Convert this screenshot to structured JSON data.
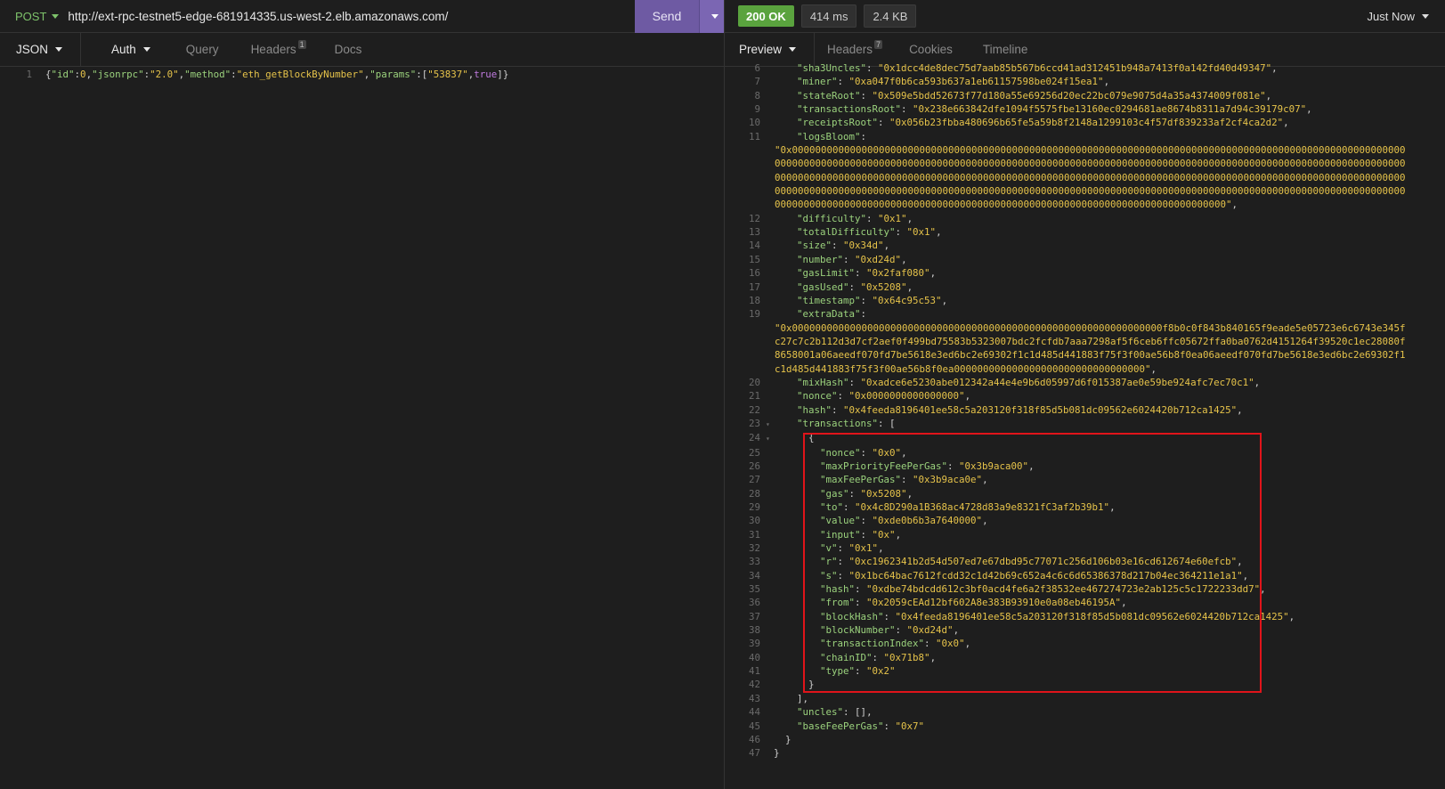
{
  "request": {
    "method": "POST",
    "url": "http://ext-rpc-testnet5-edge-681914335.us-west-2.elb.amazonaws.com/",
    "send_label": "Send",
    "tabs": [
      {
        "label": "JSON"
      },
      {
        "label": "Auth"
      },
      {
        "label": "Query"
      },
      {
        "label": "Headers",
        "count": "1"
      },
      {
        "label": "Docs"
      }
    ],
    "body_line_number": "1",
    "body": {
      "p1": "{",
      "k1": "\"id\"",
      "c1": ":",
      "v1": "0",
      "m1": ",",
      "k2": "\"jsonrpc\"",
      "c2": ":",
      "v2": "\"2.0\"",
      "m2": ",",
      "k3": "\"method\"",
      "c3": ":",
      "v3": "\"eth_getBlockByNumber\"",
      "m3": ",",
      "k4": "\"params\"",
      "c4": ":",
      "v4a": "[",
      "v4b": "\"53837\"",
      "v4c": ",",
      "v4d": "true",
      "v4e": "]",
      "p2": "}"
    }
  },
  "response": {
    "status": "200 OK",
    "time": "414 ms",
    "size": "2.4 KB",
    "timestamp_label": "Just Now",
    "tabs": [
      {
        "label": "Preview"
      },
      {
        "label": "Headers",
        "count": "7"
      },
      {
        "label": "Cookies"
      },
      {
        "label": "Timeline"
      }
    ],
    "lines": [
      {
        "n": "6",
        "ind": "    ",
        "key": "\"sha3Uncles\"",
        "val": "\"0x1dcc4de8dec75d7aab85b567b6ccd41ad312451b948a7413f0a142fd40d49347\"",
        "end": ","
      },
      {
        "n": "7",
        "ind": "    ",
        "key": "\"miner\"",
        "val": "\"0xa047f0b6ca593b637a1eb6115759​8be024f15ea1\"",
        "end": ","
      },
      {
        "n": "8",
        "ind": "    ",
        "key": "\"stateRoot\"",
        "val": "\"0x509e5bdd52673f77d180a55e69256d20ec22bc079e9075d4a35a4374009f081e\"",
        "end": ","
      },
      {
        "n": "9",
        "ind": "    ",
        "key": "\"transactionsRoot\"",
        "val": "\"0x238e663842dfe1094f5575fbe13160ec0294681ae8674b8311a7d94c39179c07\"",
        "end": ","
      },
      {
        "n": "10",
        "ind": "    ",
        "key": "\"receiptsRoot\"",
        "val": "\"0x056b23fbba480696b65fe5a59b8f2148a1299103c4f57df839233af2cf4ca2d2\"",
        "end": ","
      },
      {
        "n": "11",
        "ind": "    ",
        "key": "\"logsBloom\"",
        "val": "",
        "end": ""
      },
      {
        "n": "",
        "wrap": "\"0x0000000000000000000000000000000000000000000000000000000000000000000000000000000000000000000000000000000000000000000000000000000000000000000000000000000000000000000000000000000000000000000000000000000000000000000000000000000000000000000000000000000000000000000000000000000000000000000000000000000000000000000000000000000000000000000000000000000000000000000000000000000000000000000000000000000000000000000000000000000000000000000000000000000000000000000000000000000000000000000000000000000000000000000000000000000\""
      },
      {
        "n": "12",
        "ind": "    ",
        "key": "\"difficulty\"",
        "val": "\"0x1\"",
        "end": ","
      },
      {
        "n": "13",
        "ind": "    ",
        "key": "\"totalDifficulty\"",
        "val": "\"0x1\"",
        "end": ","
      },
      {
        "n": "14",
        "ind": "    ",
        "key": "\"size\"",
        "val": "\"0x34d\"",
        "end": ","
      },
      {
        "n": "15",
        "ind": "    ",
        "key": "\"number\"",
        "val": "\"0xd24d\"",
        "end": ","
      },
      {
        "n": "16",
        "ind": "    ",
        "key": "\"gasLimit\"",
        "val": "\"0x2faf080\"",
        "end": ","
      },
      {
        "n": "17",
        "ind": "    ",
        "key": "\"gasUsed\"",
        "val": "\"0x5208\"",
        "end": ","
      },
      {
        "n": "18",
        "ind": "    ",
        "key": "\"timestamp\"",
        "val": "\"0x64c95c53\"",
        "end": ","
      },
      {
        "n": "19",
        "ind": "    ",
        "key": "\"extraData\"",
        "val": "",
        "end": ""
      },
      {
        "n": "",
        "wrap": "\"0x0000000000000000000000000000000000000000000000000000000000000000f8b0c0f843b840165f9eade5e05723e6c6743e345fc27c7c2b112d3d7cf2aef0f499bd75583b5323007bdc2fcfdb7aaa7298af5f6ceb6ffc05672ffa0ba0762d4151264f39520c1ec28080f8658001a06aeedf070fd7be5618e3ed6bc2e69302f1c1d485d441883f75f3f00ae56b8f0ea06aeedf070fd7be5618e3ed6bc2e69302f1c1d485d441883f75f3f00ae56b8f0ea000000000000000000000000000000000\""
      },
      {
        "n": "20",
        "ind": "    ",
        "key": "\"mixHash\"",
        "val": "\"0xadce6e5230abe012342a44e4e9b6d05997d6f015387ae0e59be924afc7ec70c1\"",
        "end": ","
      },
      {
        "n": "21",
        "ind": "    ",
        "key": "\"nonce\"",
        "val": "\"0x0000000000000000\"",
        "end": ","
      },
      {
        "n": "22",
        "ind": "    ",
        "key": "\"hash\"",
        "val": "\"0x4feeda8196401ee58c5a203120f318f85d5b081dc09562e6024420b712ca1425\"",
        "end": ","
      },
      {
        "n": "23",
        "ind": "    ",
        "key": "\"transactions\"",
        "val": "[",
        "end": "",
        "fold": true
      },
      {
        "n": "24",
        "ind": "      ",
        "punct": "{",
        "fold": true
      },
      {
        "n": "25",
        "ind": "        ",
        "key": "\"nonce\"",
        "val": "\"0x0\"",
        "end": ","
      },
      {
        "n": "26",
        "ind": "        ",
        "key": "\"maxPriorityFeePerGas\"",
        "val": "\"0x3b9aca00\"",
        "end": ","
      },
      {
        "n": "27",
        "ind": "        ",
        "key": "\"maxFeePerGas\"",
        "val": "\"0x3b9aca0e\"",
        "end": ","
      },
      {
        "n": "28",
        "ind": "        ",
        "key": "\"gas\"",
        "val": "\"0x5208\"",
        "end": ","
      },
      {
        "n": "29",
        "ind": "        ",
        "key": "\"to\"",
        "val": "\"0x4c8D290a1B368ac4728d83a9e8321fC3af2b39b1\"",
        "end": ","
      },
      {
        "n": "30",
        "ind": "        ",
        "key": "\"value\"",
        "val": "\"0xde0b6b3a7640000\"",
        "end": ","
      },
      {
        "n": "31",
        "ind": "        ",
        "key": "\"input\"",
        "val": "\"0x\"",
        "end": ","
      },
      {
        "n": "32",
        "ind": "        ",
        "key": "\"v\"",
        "val": "\"0x1\"",
        "end": ","
      },
      {
        "n": "33",
        "ind": "        ",
        "key": "\"r\"",
        "val": "\"0xc1962341b2d54d507ed7e67dbd95c77071c256d106b03e16cd612674e60efcb\"",
        "end": ","
      },
      {
        "n": "34",
        "ind": "        ",
        "key": "\"s\"",
        "val": "\"0x1bc64bac7612fcdd32c1d42b69c652a4c6c6d65386378d217b04ec364211e1a1\"",
        "end": ","
      },
      {
        "n": "35",
        "ind": "        ",
        "key": "\"hash\"",
        "val": "\"0xdbe74bdcdd612c3bf0acd4fe6a2f38532ee467274723e2ab125c5c1722233dd7\"",
        "end": ","
      },
      {
        "n": "36",
        "ind": "        ",
        "key": "\"from\"",
        "val": "\"0x2059cEAd12bf602A8e383B93910e0a08eb46195A\"",
        "end": ","
      },
      {
        "n": "37",
        "ind": "        ",
        "key": "\"blockHash\"",
        "val": "\"0x4feeda8196401ee58c5a203120f318f85d5b081dc09562e6024420b712ca1425\"",
        "end": ","
      },
      {
        "n": "38",
        "ind": "        ",
        "key": "\"blockNumber\"",
        "val": "\"0xd24d\"",
        "end": ","
      },
      {
        "n": "39",
        "ind": "        ",
        "key": "\"transactionIndex\"",
        "val": "\"0x0\"",
        "end": ","
      },
      {
        "n": "40",
        "ind": "        ",
        "key": "\"chainID\"",
        "val": "\"0x71b8\"",
        "end": ","
      },
      {
        "n": "41",
        "ind": "        ",
        "key": "\"type\"",
        "val": "\"0x2\"",
        "end": ""
      },
      {
        "n": "42",
        "ind": "      ",
        "punct": "}"
      },
      {
        "n": "43",
        "ind": "    ",
        "punct": "],"
      },
      {
        "n": "44",
        "ind": "    ",
        "key": "\"uncles\"",
        "val": "[]",
        "end": ","
      },
      {
        "n": "45",
        "ind": "    ",
        "key": "\"baseFeePerGas\"",
        "val": "\"0x7\"",
        "end": ""
      },
      {
        "n": "46",
        "ind": "  ",
        "punct": "}"
      },
      {
        "n": "47",
        "ind": "",
        "punct": "}"
      }
    ]
  },
  "colors": {
    "accent": "#6e5aa3",
    "status_ok": "#5aa33e",
    "highlight": "#e0141a",
    "json_key": "#9bd27d",
    "json_string": "#e6c34a"
  }
}
